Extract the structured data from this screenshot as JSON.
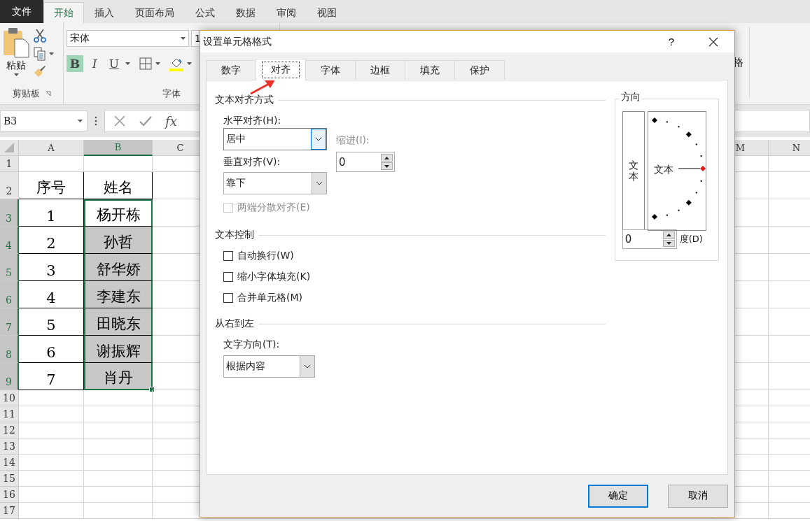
{
  "menu_tabs": [
    {
      "label": "文件",
      "kind": "file",
      "selected": false
    },
    {
      "label": "开始",
      "kind": "tab",
      "selected": true
    },
    {
      "label": "插入",
      "kind": "tab",
      "selected": false
    },
    {
      "label": "页面布局",
      "kind": "tab",
      "selected": false
    },
    {
      "label": "公式",
      "kind": "tab",
      "selected": false
    },
    {
      "label": "数据",
      "kind": "tab",
      "selected": false
    },
    {
      "label": "审阅",
      "kind": "tab",
      "selected": false
    },
    {
      "label": "视图",
      "kind": "tab",
      "selected": false
    }
  ],
  "ribbon": {
    "clipboard": {
      "paste_label": "粘贴",
      "group_label": "剪贴板"
    },
    "font": {
      "font_name": "宋体",
      "font_size": "1",
      "bold": true,
      "bold_label": "B",
      "italic_label": "I",
      "underline_label": "U",
      "group_label": "字体"
    },
    "right_label": "格"
  },
  "formula_bar": {
    "name_box": "B3",
    "function_label": "fx"
  },
  "sheet": {
    "columns": [
      {
        "label": "A",
        "selected": false
      },
      {
        "label": "B",
        "selected": true
      },
      {
        "label": "C",
        "selected": false
      }
    ],
    "right_columns": [
      {
        "label": "M",
        "selected": false
      },
      {
        "label": "N",
        "selected": false
      }
    ],
    "rows": [
      {
        "label": "1",
        "selected": false
      },
      {
        "label": "2",
        "selected": false,
        "cells": [
          {
            "text": "序号",
            "active": false
          },
          {
            "text": "姓名",
            "active": false
          }
        ]
      },
      {
        "label": "3",
        "selected": true,
        "cells": [
          {
            "text": "1",
            "active": false
          },
          {
            "text": "杨开栋",
            "active": true
          }
        ]
      },
      {
        "label": "4",
        "selected": true,
        "cells": [
          {
            "text": "2",
            "active": false
          },
          {
            "text": "孙哲",
            "active": false
          }
        ]
      },
      {
        "label": "5",
        "selected": true,
        "cells": [
          {
            "text": "3",
            "active": false
          },
          {
            "text": "舒华娇",
            "active": false
          }
        ]
      },
      {
        "label": "6",
        "selected": true,
        "cells": [
          {
            "text": "4",
            "active": false
          },
          {
            "text": "李建东",
            "active": false
          }
        ]
      },
      {
        "label": "7",
        "selected": true,
        "cells": [
          {
            "text": "5",
            "active": false
          },
          {
            "text": "田晓东",
            "active": false
          }
        ]
      },
      {
        "label": "8",
        "selected": true,
        "cells": [
          {
            "text": "6",
            "active": false
          },
          {
            "text": "谢振辉",
            "active": false
          }
        ]
      },
      {
        "label": "9",
        "selected": true,
        "cells": [
          {
            "text": "7",
            "active": false
          },
          {
            "text": "肖丹",
            "active": false
          }
        ]
      },
      {
        "label": "10",
        "selected": false
      },
      {
        "label": "11",
        "selected": false
      },
      {
        "label": "12",
        "selected": false
      },
      {
        "label": "13",
        "selected": false
      },
      {
        "label": "14",
        "selected": false
      },
      {
        "label": "15",
        "selected": false
      },
      {
        "label": "16",
        "selected": false
      },
      {
        "label": "17",
        "selected": false
      }
    ]
  },
  "dialog": {
    "title": "设置单元格格式",
    "help": "?",
    "tabs": [
      {
        "label": "数字",
        "selected": false
      },
      {
        "label": "对齐",
        "selected": true
      },
      {
        "label": "字体",
        "selected": false
      },
      {
        "label": "边框",
        "selected": false
      },
      {
        "label": "填充",
        "selected": false
      },
      {
        "label": "保护",
        "selected": false
      }
    ],
    "text_alignment": {
      "heading": "文本对齐方式",
      "horizontal": {
        "label": "水平对齐(H):",
        "value": "居中",
        "focused": true
      },
      "vertical": {
        "label": "垂直对齐(V):",
        "value": "靠下",
        "focused": false
      },
      "indent": {
        "label": "缩进(I):",
        "value": "0",
        "disabled": true
      },
      "distributed": {
        "label": "两端分散对齐(E)",
        "checked": false,
        "disabled": true
      }
    },
    "text_control": {
      "heading": "文本控制",
      "options": [
        {
          "label": "自动换行(W)",
          "checked": false,
          "disabled": false
        },
        {
          "label": "缩小字体填充(K)",
          "checked": false,
          "disabled": false
        },
        {
          "label": "合并单元格(M)",
          "checked": false,
          "disabled": false
        }
      ]
    },
    "right_to_left": {
      "heading": "从右到左",
      "direction": {
        "label": "文字方向(T):",
        "value": "根据内容",
        "focused": false
      }
    },
    "orientation": {
      "heading": "方向",
      "vertical_text": "文本",
      "dial_text": "文本",
      "degrees": {
        "value": "0",
        "label": "度(D)"
      }
    },
    "buttons": [
      {
        "label": "确定",
        "kind": "default"
      },
      {
        "label": "取消",
        "kind": "normal"
      }
    ]
  },
  "annotation": {
    "kind": "arrow"
  }
}
